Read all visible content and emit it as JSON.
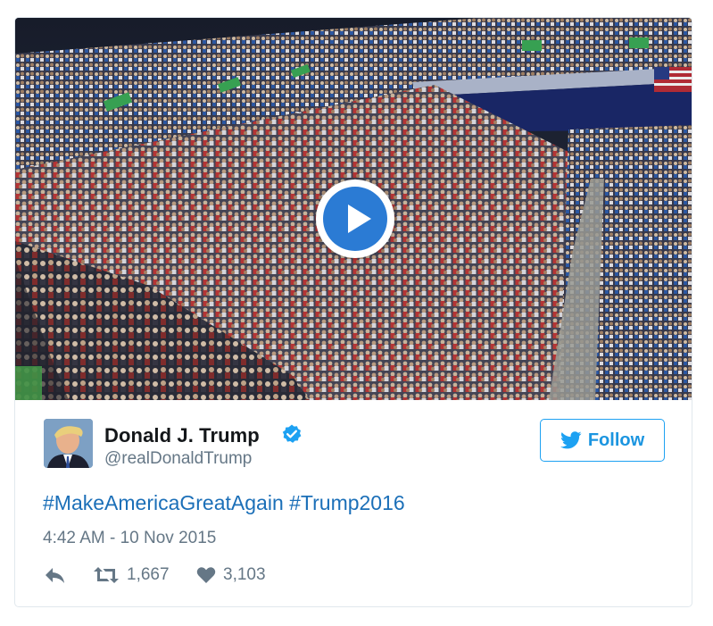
{
  "tweet": {
    "author_name": "Donald J. Trump",
    "handle": "@realDonaldTrump",
    "verified": true,
    "follow_label": "Follow",
    "hashtags": [
      "#MakeAmericaGreatAgain",
      "#Trump2016"
    ],
    "timestamp": "4:42 AM - 10 Nov 2015",
    "retweet_count": "1,667",
    "like_count": "3,103"
  },
  "media": {
    "type": "video",
    "description_icon": "play-icon"
  },
  "colors": {
    "accent_blue": "#1da1f2",
    "link_blue": "#1b6fb8",
    "secondary_text": "#657786",
    "play_blue": "#2b7bd4"
  },
  "icons": [
    "play-icon",
    "verified-badge-icon",
    "twitter-bird-icon",
    "reply-icon",
    "retweet-icon",
    "heart-icon"
  ]
}
